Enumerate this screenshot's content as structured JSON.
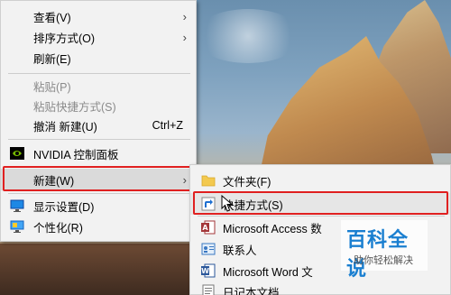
{
  "context_menu": {
    "view": "查看(V)",
    "sort_by": "排序方式(O)",
    "refresh": "刷新(E)",
    "paste": "粘贴(P)",
    "paste_shortcut": "粘贴快捷方式(S)",
    "undo_new": "撤消 新建(U)",
    "undo_shortcut": "Ctrl+Z",
    "nvidia": "NVIDIA 控制面板",
    "new": "新建(W)",
    "display_settings": "显示设置(D)",
    "personalize": "个性化(R)"
  },
  "new_submenu": {
    "folder": "文件夹(F)",
    "shortcut": "快捷方式(S)",
    "access": "Microsoft Access 数",
    "contacts": "联系人",
    "word": "Microsoft Word 文",
    "text": "日记本文档"
  },
  "watermark": {
    "title": "百科全说",
    "subtitle": "助你轻松解决"
  },
  "colors": {
    "highlight_border": "#e02020",
    "menu_bg": "#f2f2f2",
    "watermark_blue": "#1a7fd0"
  }
}
